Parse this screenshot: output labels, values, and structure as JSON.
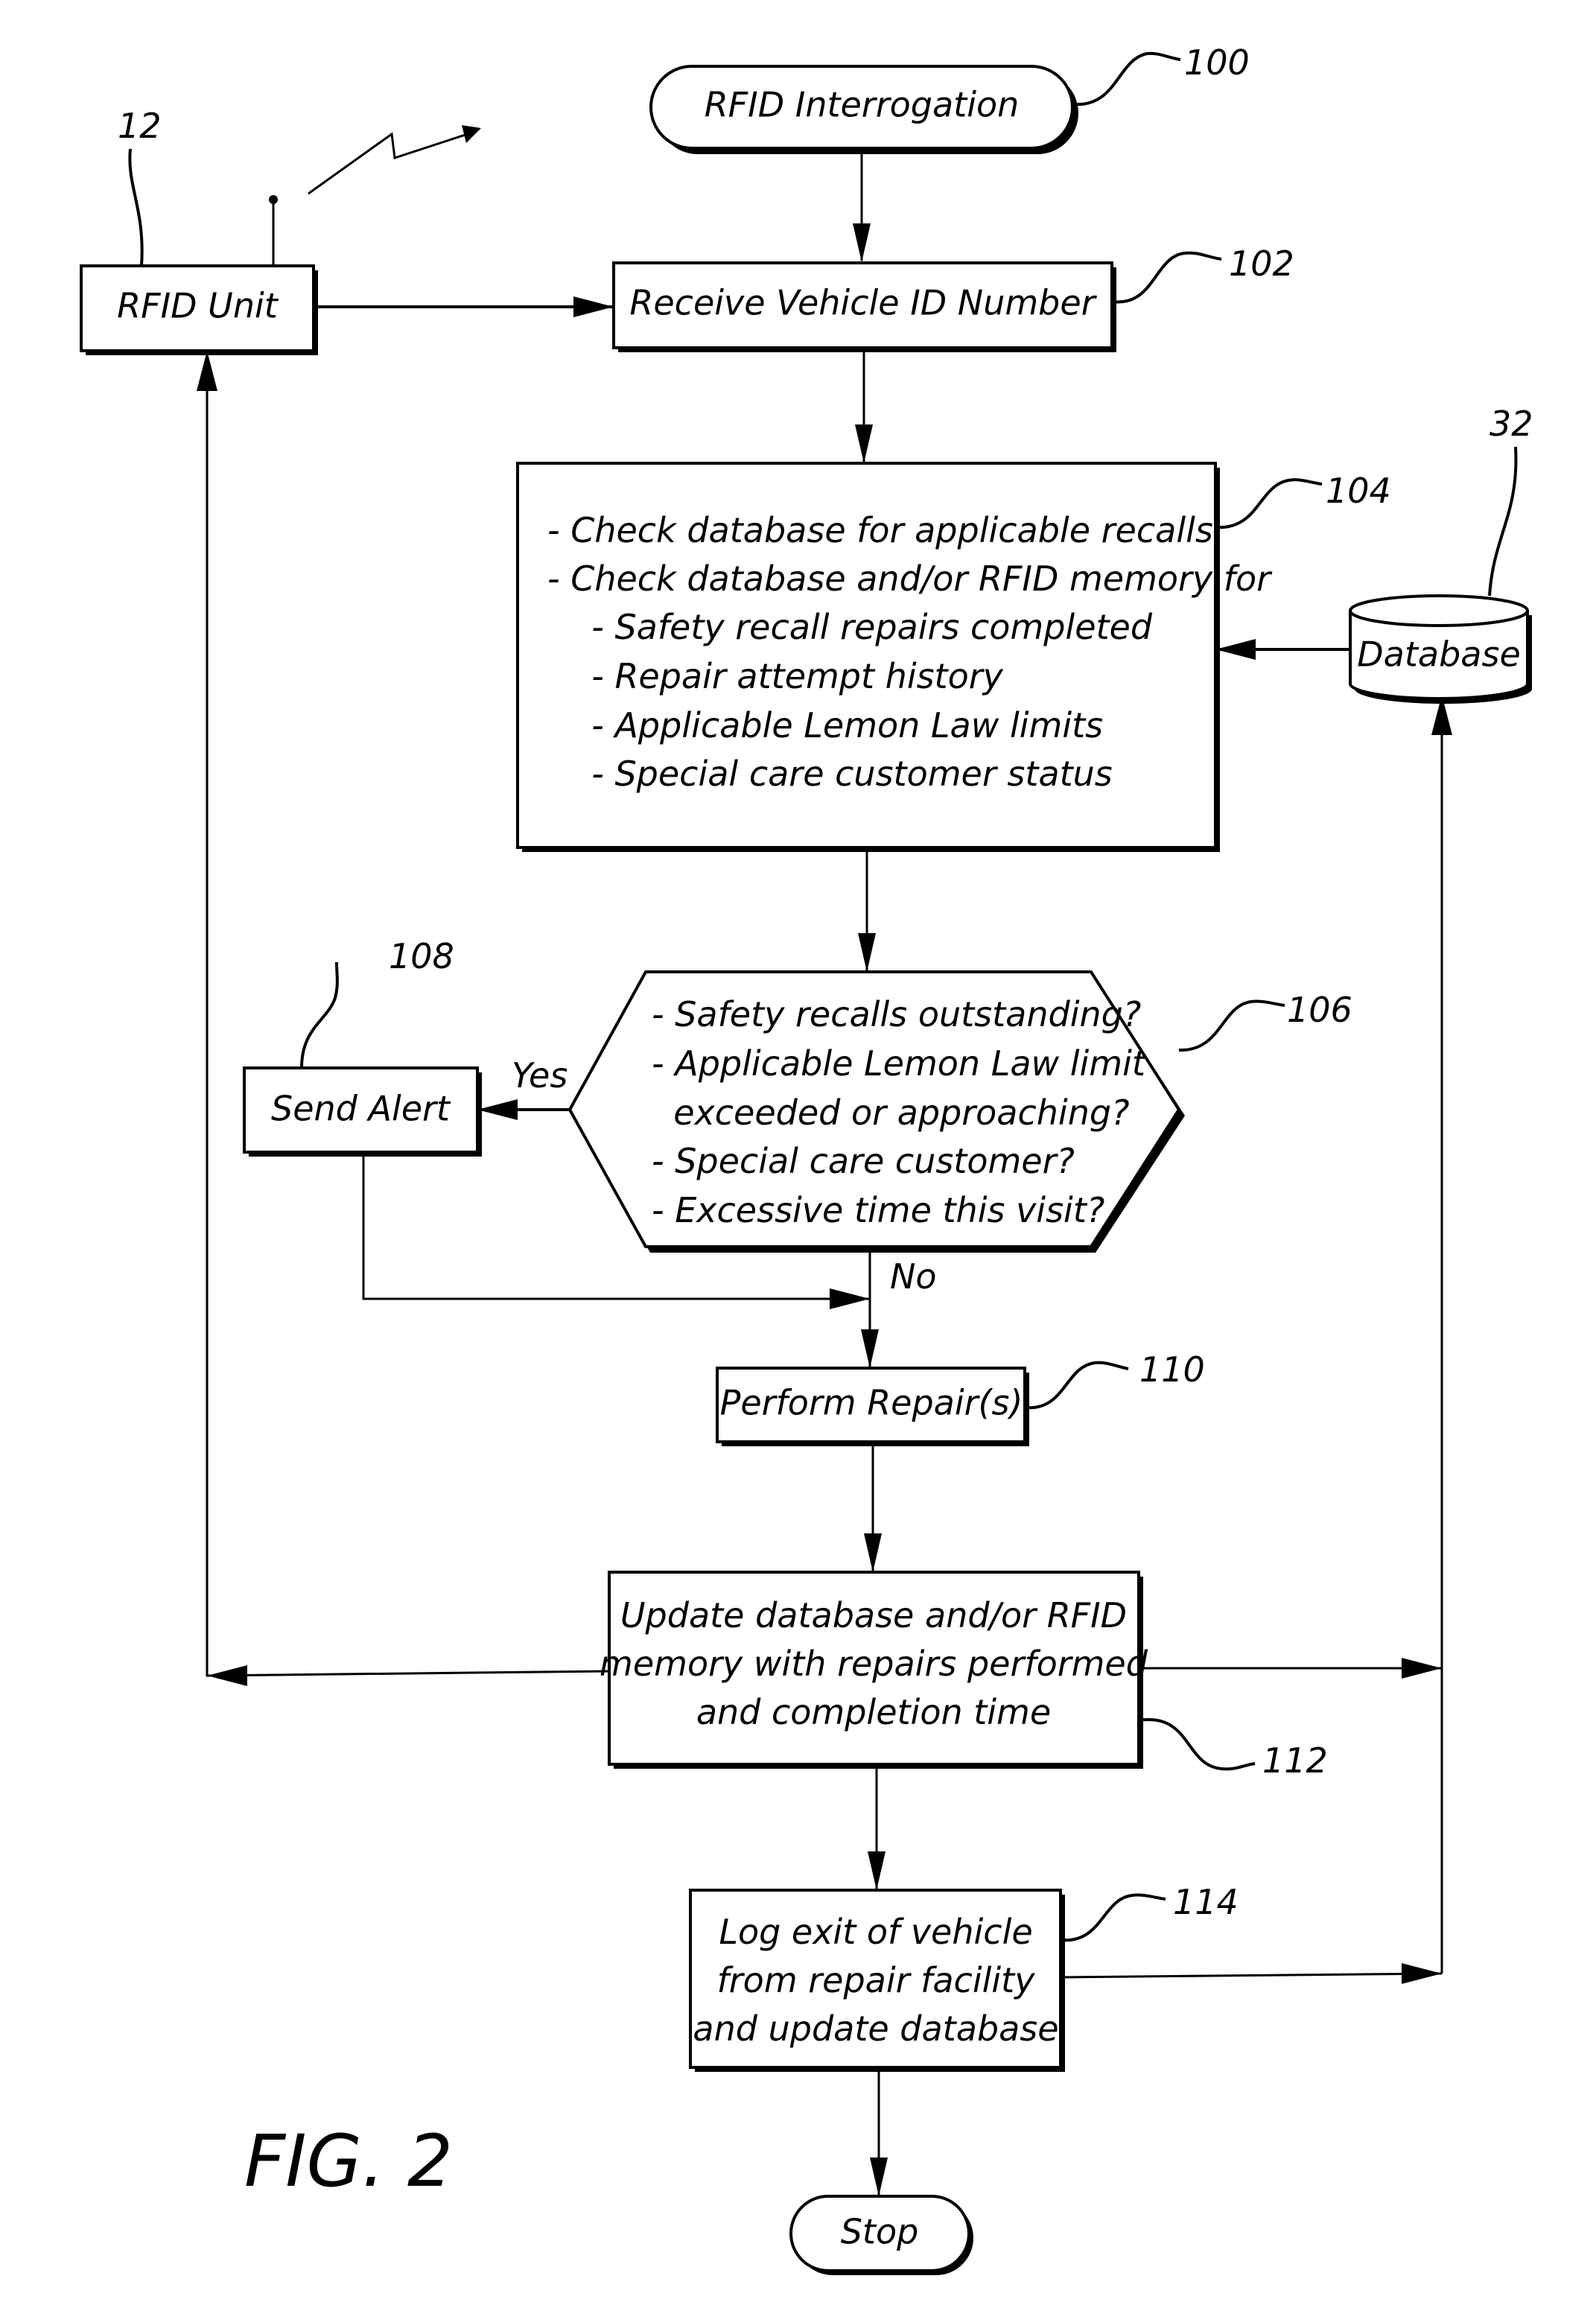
{
  "figure": {
    "label": "FIG. 2"
  },
  "nodes": {
    "start": {
      "ref": "100",
      "label": "RFID Interrogation"
    },
    "rfid_unit": {
      "ref": "12",
      "label": "RFID Unit"
    },
    "receive_vin": {
      "ref": "102",
      "label": "Receive Vehicle ID Number"
    },
    "check_db": {
      "ref": "104",
      "lines": [
        "- Check database for applicable recalls",
        "- Check database and/or RFID memory for",
        "  - Safety recall repairs completed",
        "  - Repair attempt history",
        "  - Applicable Lemon Law limits",
        "  - Special care customer status"
      ]
    },
    "database": {
      "ref": "32",
      "label": "Database"
    },
    "decision": {
      "ref": "106",
      "lines": [
        "- Safety recalls outstanding?",
        "- Applicable Lemon Law limit",
        "  exceeded or approaching?",
        "- Special care customer?",
        "- Excessive time this visit?"
      ],
      "yes_label": "Yes",
      "no_label": "No"
    },
    "send_alert": {
      "ref": "108",
      "label": "Send Alert"
    },
    "perform_repair": {
      "ref": "110",
      "label": "Perform Repair(s)"
    },
    "update_db": {
      "ref": "112",
      "lines": [
        "Update database and/or RFID",
        "memory with repairs performed",
        "and completion time"
      ]
    },
    "log_exit": {
      "ref": "114",
      "lines": [
        "Log exit of vehicle",
        "from repair facility",
        "and update database"
      ]
    },
    "stop": {
      "label": "Stop"
    }
  }
}
